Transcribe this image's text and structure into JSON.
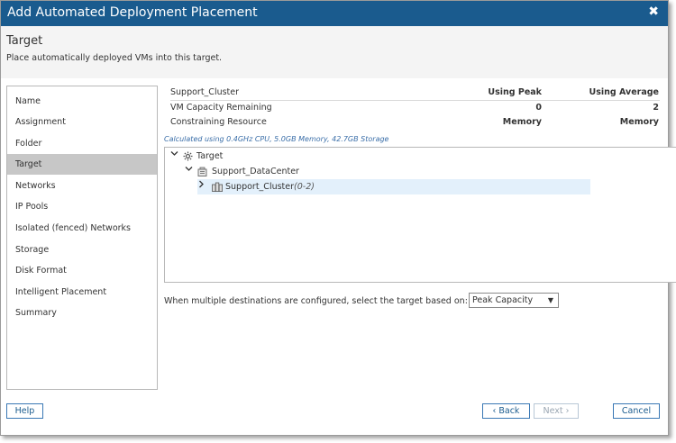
{
  "dialog": {
    "title": "Add Automated Deployment Placement",
    "close": "✖"
  },
  "header": {
    "title": "Target",
    "subtitle": "Place automatically deployed VMs into this target."
  },
  "nav": {
    "items": [
      "Name",
      "Assignment",
      "Folder",
      "Target",
      "Networks",
      "IP Pools",
      "Isolated (fenced) Networks",
      "Storage",
      "Disk Format",
      "Intelligent Placement",
      "Summary"
    ],
    "active_index": 3
  },
  "summary": {
    "cluster": "Support_Cluster",
    "col_peak": "Using Peak",
    "col_avg": "Using Average",
    "rows": [
      {
        "label": "VM Capacity Remaining",
        "peak": "0",
        "avg": "2"
      },
      {
        "label": "Constraining Resource",
        "peak": "Memory",
        "avg": "Memory"
      }
    ],
    "calc_note": "Calculated using 0.4GHz CPU, 5.0GB Memory, 42.7GB Storage"
  },
  "tree": {
    "root": "Target",
    "datacenter": "Support_DataCenter",
    "cluster": "Support_Cluster",
    "cluster_range": "(0-2)"
  },
  "selection": {
    "label": "When multiple destinations are configured, select the target based on:",
    "value": "Peak Capacity"
  },
  "buttons": {
    "help": "Help",
    "back": "Back",
    "next": "Next",
    "cancel": "Cancel"
  },
  "colors": {
    "titlebar": "#1a5b8e",
    "accent": "#3a78b5",
    "nav_active": "#c7c7c7",
    "tree_selected": "#e3f0fb"
  }
}
